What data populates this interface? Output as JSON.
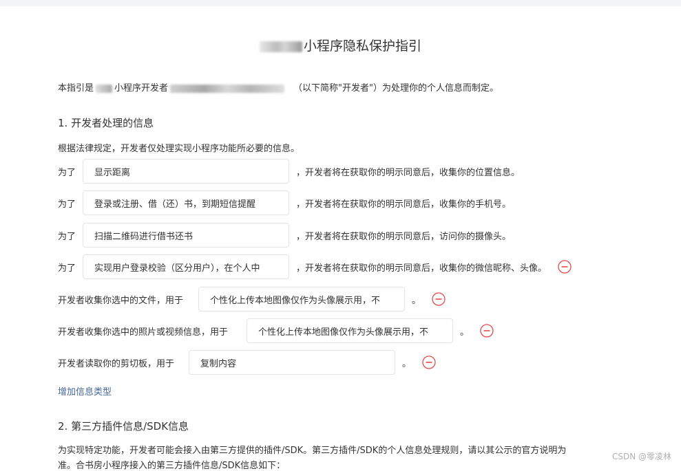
{
  "title": "小程序隐私保护指引",
  "intro": {
    "prefix": "本指引是",
    "mid": "小程序开发者",
    "suffix": "（以下简称\"开发者\"）为处理你的个人信息而制定。"
  },
  "section1": {
    "heading": "1.  开发者处理的信息",
    "desc": "根据法律规定，开发者仅处理实现小程序功能所必要的信息。",
    "rows": [
      {
        "prefix": "为了",
        "value": "显示距离",
        "suffix": "，开发者将在获取你的明示同意后，收集你的位置信息。"
      },
      {
        "prefix": "为了",
        "value": "登录或注册、借（还）书，到期短信提醒",
        "suffix": "，开发者将在获取你的明示同意后，收集你的手机号。"
      },
      {
        "prefix": "为了",
        "value": "扫描二维码进行借书还书",
        "suffix": "，开发者将在获取你的明示同意后，访问你的摄像头。"
      },
      {
        "prefix": "为了",
        "value": "实现用户登录校验（区分用户），在个人中",
        "suffix": "，开发者将在获取你的明示同意后，收集你的微信昵称、头像。"
      }
    ],
    "file_row": {
      "prefix": "开发者收集你选中的文件，用于",
      "value": "个性化上传本地图像仅作为头像展示用，不",
      "suffix": "。"
    },
    "photo_row": {
      "prefix": "开发者收集你选中的照片或视频信息，用于",
      "value": "个性化上传本地图像仅作为头像展示用，不",
      "suffix": "。"
    },
    "clip_row": {
      "prefix": "开发者读取你的剪切板，用于",
      "value": "复制内容",
      "suffix": "。"
    },
    "add_link": "增加信息类型"
  },
  "section2": {
    "heading": "2.  第三方插件信息/SDK信息",
    "line1": "为实现特定功能，开发者可能会接入由第三方提供的插件/SDK。第三方插件/SDK的个人信息处理规则，请以其公示的官方说明为",
    "line2": "准。合书房小程序接入的第三方插件信息/SDK信息如下："
  },
  "watermark": "CSDN @零凌林",
  "colors": {
    "remove_icon": "#e84a4a",
    "link": "#47679a"
  }
}
